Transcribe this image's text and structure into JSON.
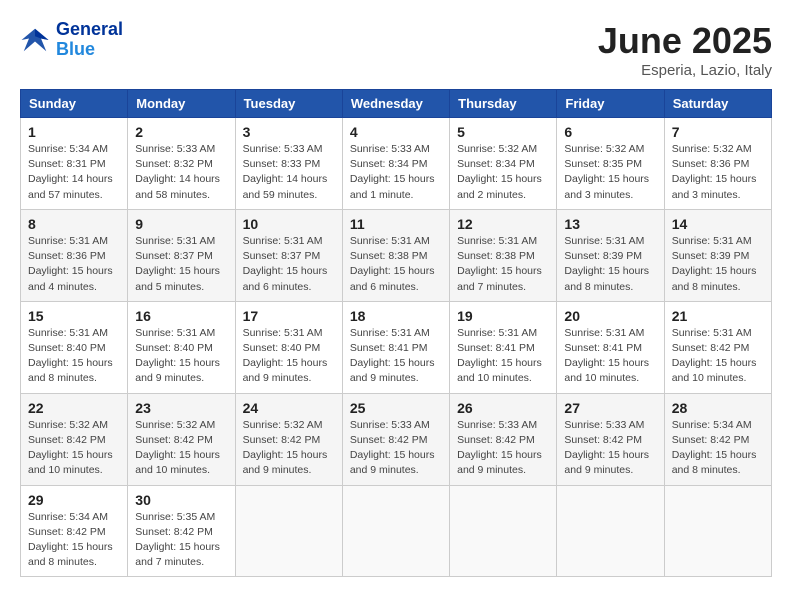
{
  "header": {
    "logo_general": "General",
    "logo_blue": "Blue",
    "month_year": "June 2025",
    "location": "Esperia, Lazio, Italy"
  },
  "weekdays": [
    "Sunday",
    "Monday",
    "Tuesday",
    "Wednesday",
    "Thursday",
    "Friday",
    "Saturday"
  ],
  "weeks": [
    [
      {
        "day": "1",
        "info": "Sunrise: 5:34 AM\nSunset: 8:31 PM\nDaylight: 14 hours\nand 57 minutes."
      },
      {
        "day": "2",
        "info": "Sunrise: 5:33 AM\nSunset: 8:32 PM\nDaylight: 14 hours\nand 58 minutes."
      },
      {
        "day": "3",
        "info": "Sunrise: 5:33 AM\nSunset: 8:33 PM\nDaylight: 14 hours\nand 59 minutes."
      },
      {
        "day": "4",
        "info": "Sunrise: 5:33 AM\nSunset: 8:34 PM\nDaylight: 15 hours\nand 1 minute."
      },
      {
        "day": "5",
        "info": "Sunrise: 5:32 AM\nSunset: 8:34 PM\nDaylight: 15 hours\nand 2 minutes."
      },
      {
        "day": "6",
        "info": "Sunrise: 5:32 AM\nSunset: 8:35 PM\nDaylight: 15 hours\nand 3 minutes."
      },
      {
        "day": "7",
        "info": "Sunrise: 5:32 AM\nSunset: 8:36 PM\nDaylight: 15 hours\nand 3 minutes."
      }
    ],
    [
      {
        "day": "8",
        "info": "Sunrise: 5:31 AM\nSunset: 8:36 PM\nDaylight: 15 hours\nand 4 minutes."
      },
      {
        "day": "9",
        "info": "Sunrise: 5:31 AM\nSunset: 8:37 PM\nDaylight: 15 hours\nand 5 minutes."
      },
      {
        "day": "10",
        "info": "Sunrise: 5:31 AM\nSunset: 8:37 PM\nDaylight: 15 hours\nand 6 minutes."
      },
      {
        "day": "11",
        "info": "Sunrise: 5:31 AM\nSunset: 8:38 PM\nDaylight: 15 hours\nand 6 minutes."
      },
      {
        "day": "12",
        "info": "Sunrise: 5:31 AM\nSunset: 8:38 PM\nDaylight: 15 hours\nand 7 minutes."
      },
      {
        "day": "13",
        "info": "Sunrise: 5:31 AM\nSunset: 8:39 PM\nDaylight: 15 hours\nand 8 minutes."
      },
      {
        "day": "14",
        "info": "Sunrise: 5:31 AM\nSunset: 8:39 PM\nDaylight: 15 hours\nand 8 minutes."
      }
    ],
    [
      {
        "day": "15",
        "info": "Sunrise: 5:31 AM\nSunset: 8:40 PM\nDaylight: 15 hours\nand 8 minutes."
      },
      {
        "day": "16",
        "info": "Sunrise: 5:31 AM\nSunset: 8:40 PM\nDaylight: 15 hours\nand 9 minutes."
      },
      {
        "day": "17",
        "info": "Sunrise: 5:31 AM\nSunset: 8:40 PM\nDaylight: 15 hours\nand 9 minutes."
      },
      {
        "day": "18",
        "info": "Sunrise: 5:31 AM\nSunset: 8:41 PM\nDaylight: 15 hours\nand 9 minutes."
      },
      {
        "day": "19",
        "info": "Sunrise: 5:31 AM\nSunset: 8:41 PM\nDaylight: 15 hours\nand 10 minutes."
      },
      {
        "day": "20",
        "info": "Sunrise: 5:31 AM\nSunset: 8:41 PM\nDaylight: 15 hours\nand 10 minutes."
      },
      {
        "day": "21",
        "info": "Sunrise: 5:31 AM\nSunset: 8:42 PM\nDaylight: 15 hours\nand 10 minutes."
      }
    ],
    [
      {
        "day": "22",
        "info": "Sunrise: 5:32 AM\nSunset: 8:42 PM\nDaylight: 15 hours\nand 10 minutes."
      },
      {
        "day": "23",
        "info": "Sunrise: 5:32 AM\nSunset: 8:42 PM\nDaylight: 15 hours\nand 10 minutes."
      },
      {
        "day": "24",
        "info": "Sunrise: 5:32 AM\nSunset: 8:42 PM\nDaylight: 15 hours\nand 9 minutes."
      },
      {
        "day": "25",
        "info": "Sunrise: 5:33 AM\nSunset: 8:42 PM\nDaylight: 15 hours\nand 9 minutes."
      },
      {
        "day": "26",
        "info": "Sunrise: 5:33 AM\nSunset: 8:42 PM\nDaylight: 15 hours\nand 9 minutes."
      },
      {
        "day": "27",
        "info": "Sunrise: 5:33 AM\nSunset: 8:42 PM\nDaylight: 15 hours\nand 9 minutes."
      },
      {
        "day": "28",
        "info": "Sunrise: 5:34 AM\nSunset: 8:42 PM\nDaylight: 15 hours\nand 8 minutes."
      }
    ],
    [
      {
        "day": "29",
        "info": "Sunrise: 5:34 AM\nSunset: 8:42 PM\nDaylight: 15 hours\nand 8 minutes."
      },
      {
        "day": "30",
        "info": "Sunrise: 5:35 AM\nSunset: 8:42 PM\nDaylight: 15 hours\nand 7 minutes."
      },
      null,
      null,
      null,
      null,
      null
    ]
  ]
}
